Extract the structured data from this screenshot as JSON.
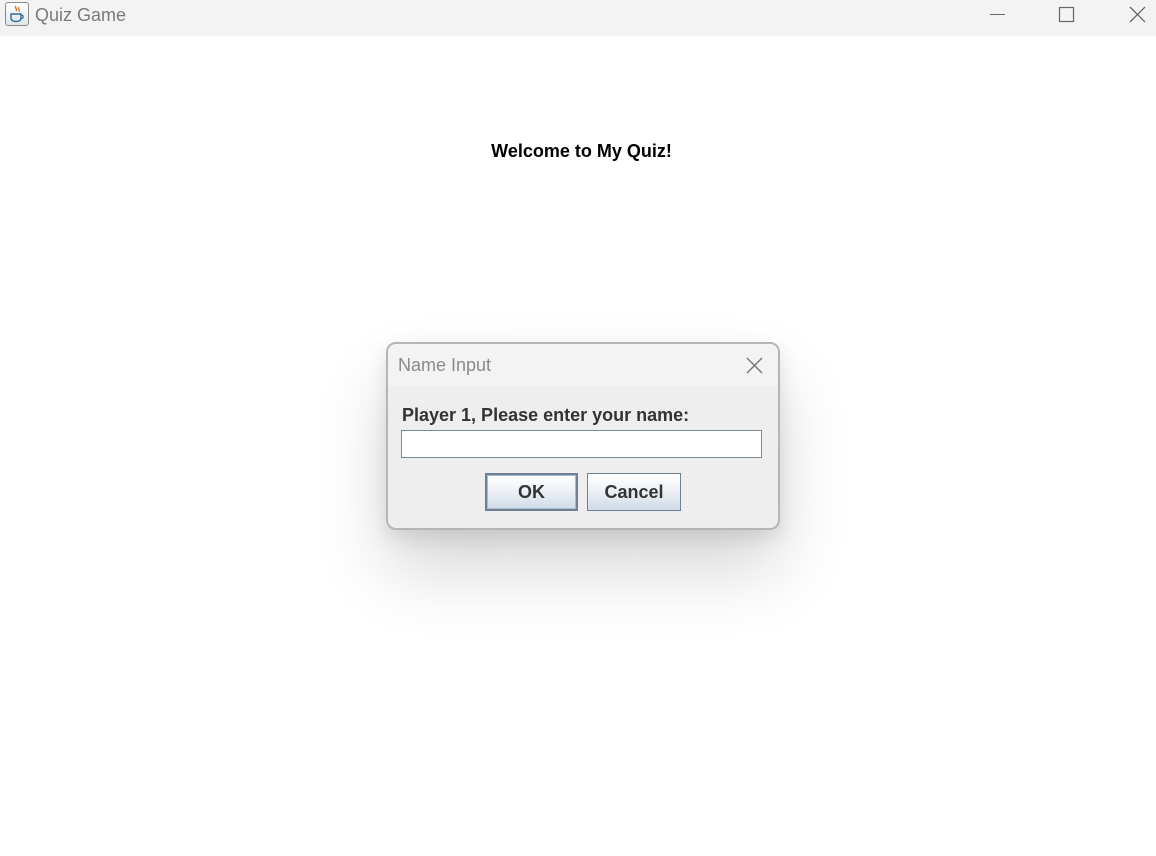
{
  "window": {
    "title": "Quiz Game",
    "icon": "java-coffee-cup-icon"
  },
  "title_controls": {
    "minimize_icon": "minimize-icon",
    "maximize_icon": "maximize-icon",
    "close_icon": "close-icon"
  },
  "main": {
    "welcome_text": "Welcome to My Quiz!"
  },
  "dialog": {
    "title": "Name Input",
    "prompt": "Player 1, Please enter your name:",
    "input_value": "",
    "ok_label": "OK",
    "cancel_label": "Cancel"
  },
  "colors": {
    "titlebar_bg": "#f3f3f3",
    "dialog_bg": "#eeeeee",
    "button_border": "#6e8092"
  }
}
